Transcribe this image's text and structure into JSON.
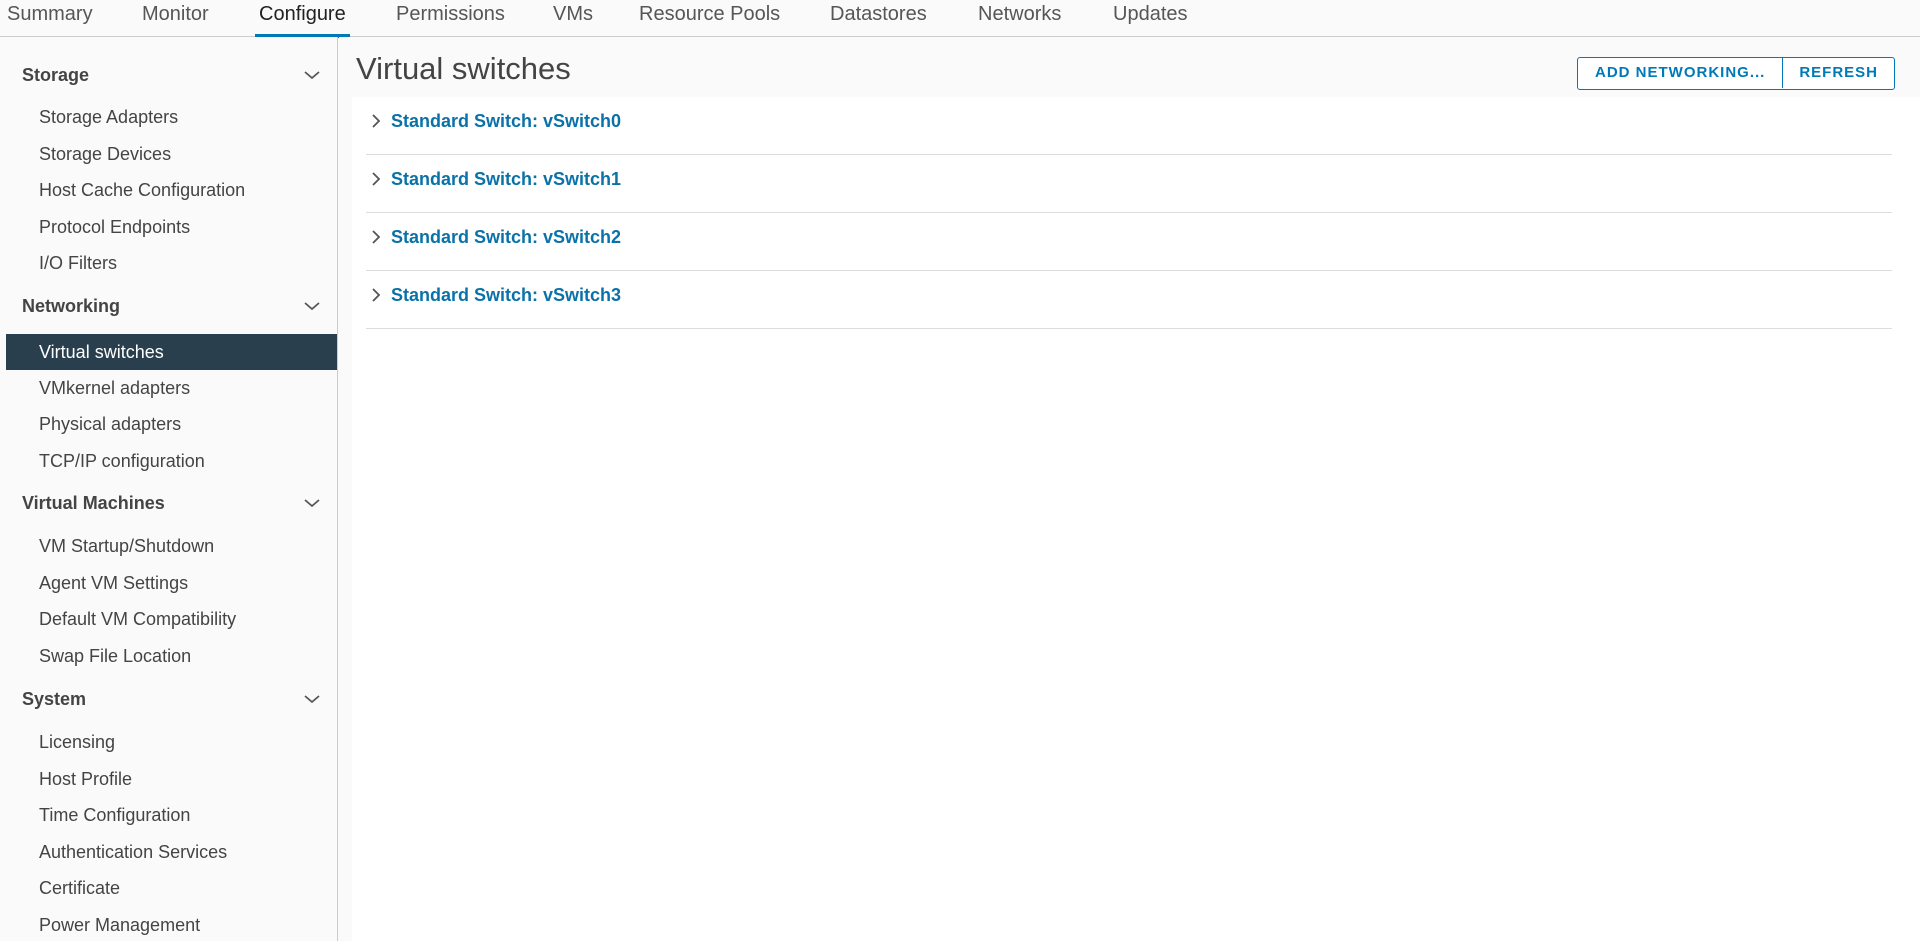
{
  "tabs": [
    {
      "label": "Summary"
    },
    {
      "label": "Monitor"
    },
    {
      "label": "Configure"
    },
    {
      "label": "Permissions"
    },
    {
      "label": "VMs"
    },
    {
      "label": "Resource Pools"
    },
    {
      "label": "Datastores"
    },
    {
      "label": "Networks"
    },
    {
      "label": "Updates"
    }
  ],
  "active_tab": "Configure",
  "sidebar": {
    "groups": [
      {
        "label": "Storage",
        "items": [
          "Storage Adapters",
          "Storage Devices",
          "Host Cache Configuration",
          "Protocol Endpoints",
          "I/O Filters"
        ]
      },
      {
        "label": "Networking",
        "items": [
          "Virtual switches",
          "VMkernel adapters",
          "Physical adapters",
          "TCP/IP configuration"
        ]
      },
      {
        "label": "Virtual Machines",
        "items": [
          "VM Startup/Shutdown",
          "Agent VM Settings",
          "Default VM Compatibility",
          "Swap File Location"
        ]
      },
      {
        "label": "System",
        "items": [
          "Licensing",
          "Host Profile",
          "Time Configuration",
          "Authentication Services",
          "Certificate",
          "Power Management"
        ]
      }
    ],
    "selected_item": "Virtual switches"
  },
  "main": {
    "title": "Virtual switches",
    "buttons": {
      "add_networking": "ADD NETWORKING...",
      "refresh": "REFRESH"
    },
    "switches": [
      "Standard Switch: vSwitch0",
      "Standard Switch: vSwitch1",
      "Standard Switch: vSwitch2",
      "Standard Switch: vSwitch3"
    ]
  },
  "colors": {
    "accent": "#0079b8",
    "link": "#0a72a8",
    "selected_bg": "#2a3f4e"
  },
  "icons": {
    "group_toggle": "chevron-down-icon",
    "row_expand": "chevron-right-icon"
  }
}
